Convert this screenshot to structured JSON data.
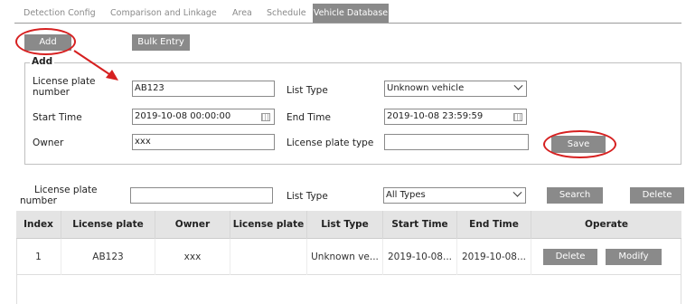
{
  "tabs": [
    "Detection Config",
    "Comparison and Linkage",
    "Area",
    "Schedule",
    "Vehicle Database"
  ],
  "active_tab": "Vehicle Database",
  "toolbar": {
    "add_label": "Add",
    "bulk_label": "Bulk Entry"
  },
  "add_form": {
    "legend": "Add",
    "plate_label_1": "License plate",
    "plate_label_2": "number",
    "plate_value": "AB123",
    "list_type_label": "List Type",
    "list_type_value": "Unknown vehicle",
    "start_label": "Start Time",
    "start_value": "2019-10-08 00:00:00",
    "end_label": "End Time",
    "end_value": "2019-10-08 23:59:59",
    "owner_label": "Owner",
    "owner_value": "xxx",
    "plate_type_label": "License plate type",
    "plate_type_value": "",
    "save_label": "Save"
  },
  "search": {
    "plate_label_1": "License plate",
    "plate_label_2": "number",
    "plate_value": "",
    "list_type_label": "List Type",
    "list_type_value": "All Types",
    "search_label": "Search",
    "delete_label": "Delete"
  },
  "table": {
    "headers": [
      "Index",
      "License plate",
      "Owner",
      "License plate",
      "List Type",
      "Start Time",
      "End Time",
      "Operate"
    ],
    "rows": [
      {
        "index": "1",
        "plate": "AB123",
        "owner": "xxx",
        "plate_type": "",
        "list_type": "Unknown ve...",
        "start": "2019-10-08...",
        "end": "2019-10-08..."
      }
    ],
    "row_delete_label": "Delete",
    "row_modify_label": "Modify"
  },
  "colors": {
    "button_gray": "#8a8a8a",
    "annotation_red": "#d62020",
    "header_bg": "#e4e4e4"
  }
}
